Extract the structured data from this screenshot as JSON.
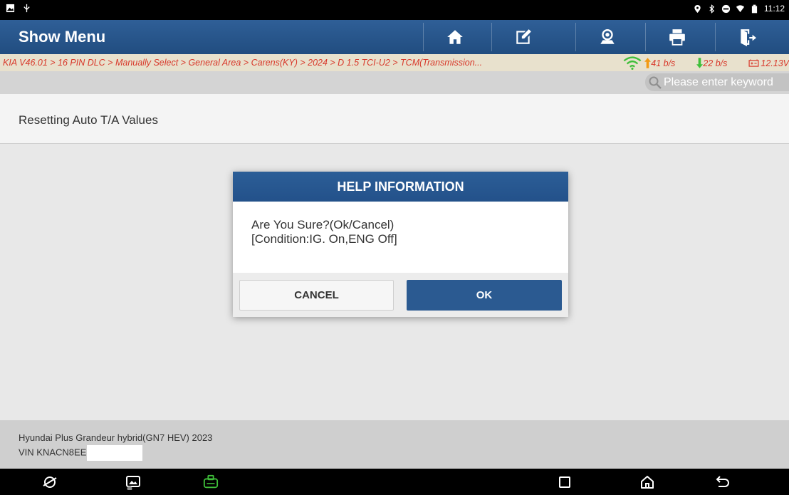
{
  "statusbar": {
    "time": "11:12",
    "left_icons": [
      "gallery-icon",
      "usb-icon"
    ],
    "right_icons": [
      "location-icon",
      "bluetooth-icon",
      "dnd-icon",
      "wifi-icon",
      "battery-icon"
    ]
  },
  "header": {
    "title": "Show Menu",
    "toolbar": [
      "home-icon",
      "report-icon",
      "feedback-icon",
      "print-icon",
      "exit-icon"
    ]
  },
  "breadcrumb": {
    "path": "KIA V46.01 > 16 PIN DLC > Manually Select > General Area > Carens(KY) > 2024 > D 1.5 TCI-U2 > TCM(Transmission...",
    "upload": "41 b/s",
    "download": "22 b/s",
    "voltage": "12.13V"
  },
  "search": {
    "placeholder": "Please enter keyword"
  },
  "list": {
    "items": [
      {
        "label": "Resetting Auto T/A Values"
      }
    ]
  },
  "footer": {
    "vehicle": "Hyundai Plus Grandeur hybrid(GN7 HEV) 2023",
    "vin_prefix": "VIN KNACN8EE"
  },
  "dialog": {
    "title": "HELP INFORMATION",
    "line1": "Are You Sure?(Ok/Cancel)",
    "line2": "[Condition:IG. On,ENG Off]",
    "cancel_label": "CANCEL",
    "ok_label": "OK"
  },
  "colors": {
    "header": "#2f5f97",
    "breadcrumb_text": "#d8382a",
    "breadcrumb_bg": "#e8e1cd",
    "vci_green": "#3fbf3a",
    "ok_button": "#2b5a91"
  }
}
